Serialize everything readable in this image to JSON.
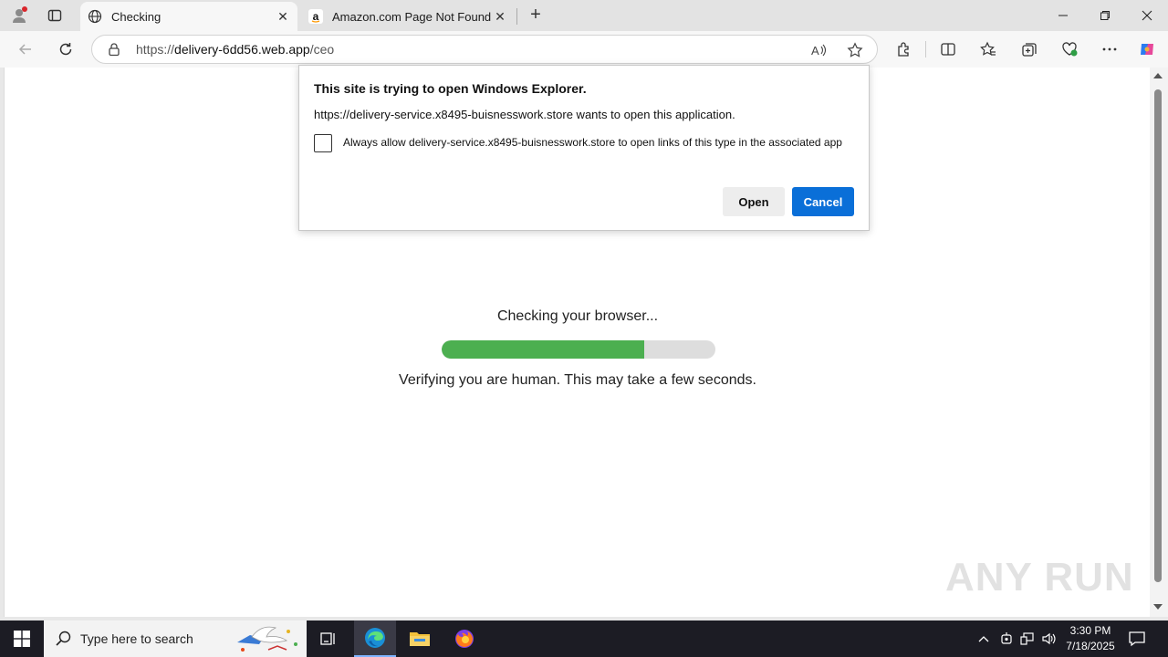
{
  "browser": {
    "tabs": [
      {
        "label": "Checking",
        "active": true
      },
      {
        "label": "Amazon.com Page Not Found",
        "active": false
      }
    ],
    "address": {
      "scheme": "https://",
      "host": "delivery-6dd56.web.app",
      "path": "/ceo"
    }
  },
  "dialog": {
    "title": "This site is trying to open Windows Explorer.",
    "message": "https://delivery-service.x8495-buisnesswork.store wants to open this application.",
    "checkbox_label": "Always allow delivery-service.x8495-buisnesswork.store to open links of this type in the associated app",
    "checkbox_checked": false,
    "open_label": "Open",
    "cancel_label": "Cancel"
  },
  "page": {
    "heading": "Checking your browser...",
    "progress_fraction": 0.74,
    "progress_color": "#4caf50",
    "subtext": "Verifying you are human. This may take a few seconds."
  },
  "watermark": "ANY RUN",
  "taskbar": {
    "search_placeholder": "Type here to search",
    "time": "3:30 PM",
    "date": "7/18/2025"
  },
  "colors": {
    "accent": "#0a6fd8"
  }
}
